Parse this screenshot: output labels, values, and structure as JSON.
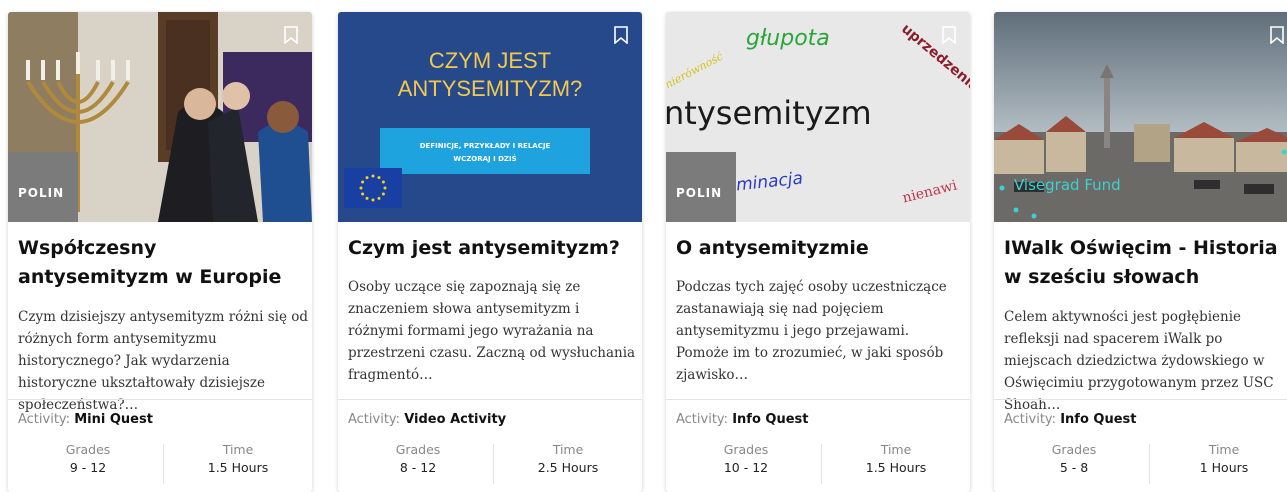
{
  "cards": [
    {
      "title": "Współczesny antysemityzm w Europie",
      "description": "Czym dzisiejszy antysemityzm różni się od różnych form antysemityzmu historycznego? Jak wydarzenia historyczne ukształtowały dzisiejsze społeczeństwa?…",
      "activity_label": "Activity:",
      "activity_type": "Mini Quest",
      "grades_label": "Grades",
      "grades": "9 - 12",
      "time_label": "Time",
      "time": "1.5 Hours",
      "thumb_logo": "POLIN",
      "bookmark_icon": "bookmark-icon"
    },
    {
      "title": "Czym jest antysemityzm?",
      "description": "Osoby uczące się zapoznają się ze znaczeniem słowa antysemityzm i różnymi formami jego wyrażania na przestrzeni czasu. Zaczną od wysłuchania fragmentó…",
      "activity_label": "Activity:",
      "activity_type": "Video Activity",
      "grades_label": "Grades",
      "grades": "8 - 12",
      "time_label": "Time",
      "time": "2.5 Hours",
      "thumb_heading_1": "CZYM JEST",
      "thumb_heading_2": "ANTYSEMITYZM?",
      "thumb_box_1": "DEFINICJE, PRZYKŁADY I RELACJE",
      "thumb_box_2": "WCZORAJ I DZIŚ",
      "bookmark_icon": "bookmark-icon"
    },
    {
      "title": "O antysemityzmie",
      "description": "Podczas tych zajęć osoby uczestniczące zastanawiają się nad pojęciem antysemityzmu i jego przejawami. Pomoże im to zrozumieć, w jaki sposób zjawisko…",
      "activity_label": "Activity:",
      "activity_type": "Info Quest",
      "grades_label": "Grades",
      "grades": "10 - 12",
      "time_label": "Time",
      "time": "1.5 Hours",
      "thumb_words": {
        "w1": "nierówność",
        "w2": "głupota",
        "w3": "uprzedzenia",
        "w4": "ntysemityzm",
        "w5": "minacja",
        "w6": "nienawi"
      },
      "thumb_logo": "POLIN",
      "bookmark_icon": "bookmark-icon"
    },
    {
      "title": "IWalk Oświęcim - Historia w sześciu słowach",
      "description": "Celem aktywności jest pogłębienie refleksji nad spacerem iWalk po miejscach dziedzictwa żydowskiego w Oświęcimiu przygotowanym przez USC Shoah…",
      "activity_label": "Activity:",
      "activity_type": "Info Quest",
      "grades_label": "Grades",
      "grades": "5 - 8",
      "time_label": "Time",
      "time": "1 Hours",
      "thumb_watermark": "Visegrad Fund",
      "bookmark_icon": "bookmark-icon"
    }
  ],
  "colors": {
    "card2_bg": "#25498a",
    "card2_heading": "#f2c94c",
    "card2_box": "#1fa3df",
    "logo_bg": "#7b7b7b"
  }
}
